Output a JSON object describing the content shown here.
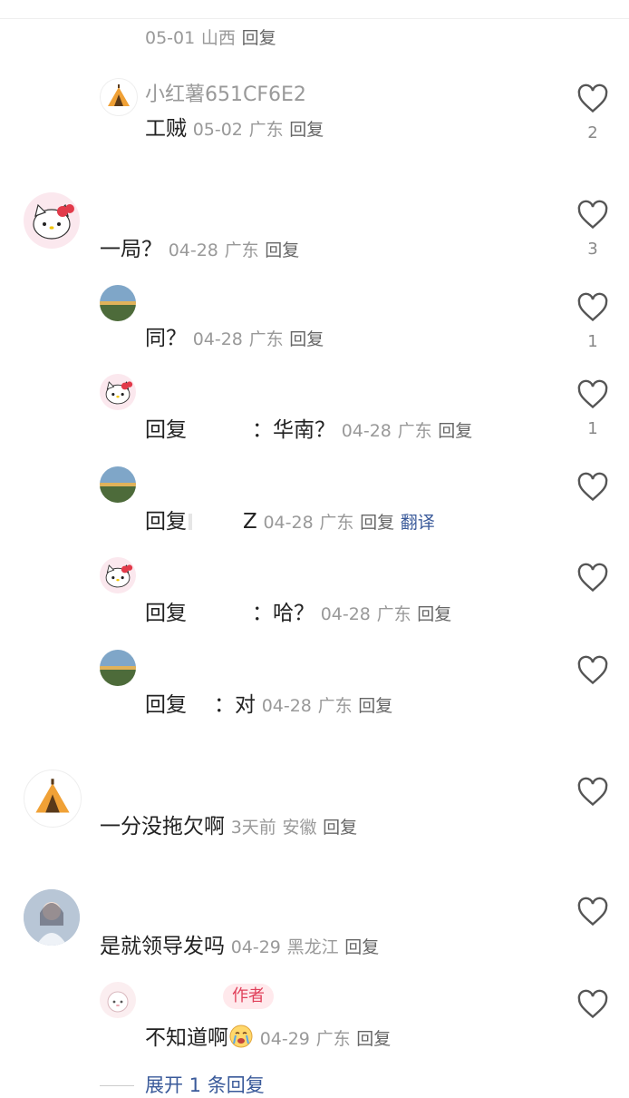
{
  "colors": {
    "meta": "#999999",
    "translate_link": "#3a5a9a",
    "author_badge_bg": "#ffe9ec",
    "author_badge_fg": "#e0405a"
  },
  "comments": [
    {
      "time": "05-01",
      "region": "山西",
      "reply": "回复"
    },
    {
      "user": "小红薯651CF6E2",
      "content": "工贼",
      "time": "05-02",
      "region": "广东",
      "reply": "回复",
      "likes": "2",
      "avatar": "tent-icon"
    },
    {
      "content": "一局？",
      "time": "04-28",
      "region": "广东",
      "reply": "回复",
      "likes": "3",
      "avatar": "hello-kitty-avatar"
    },
    {
      "content": "同？",
      "time": "04-28",
      "region": "广东",
      "reply": "回复",
      "likes": "1",
      "avatar": "landscape-avatar"
    },
    {
      "prefix": "回复",
      "content": "：华南？",
      "time": "04-28",
      "region": "广东",
      "reply": "回复",
      "likes": "1",
      "avatar": "hello-kitty-avatar"
    },
    {
      "prefix": "回复",
      "content": "Z",
      "time": "04-28",
      "region": "广东",
      "reply": "回复",
      "translate": "翻译",
      "avatar": "landscape-avatar"
    },
    {
      "prefix": "回复",
      "content": "：哈？",
      "time": "04-28",
      "region": "广东",
      "reply": "回复",
      "avatar": "hello-kitty-avatar"
    },
    {
      "prefix": "回复",
      "content": "：对",
      "time": "04-28",
      "region": "广东",
      "reply": "回复",
      "avatar": "landscape-avatar"
    },
    {
      "content": "一分没拖欠啊",
      "time": "3天前",
      "region": "安徽",
      "reply": "回复",
      "avatar": "tent-icon"
    },
    {
      "content": "是就领导发吗",
      "time": "04-29",
      "region": "黑龙江",
      "reply": "回复",
      "avatar": "girl-avatar"
    },
    {
      "badge": "作者",
      "content": "不知道啊",
      "time": "04-29",
      "region": "广东",
      "reply": "回复",
      "avatar": "sheep-avatar"
    }
  ],
  "expand_replies": "展开 1 条回复"
}
